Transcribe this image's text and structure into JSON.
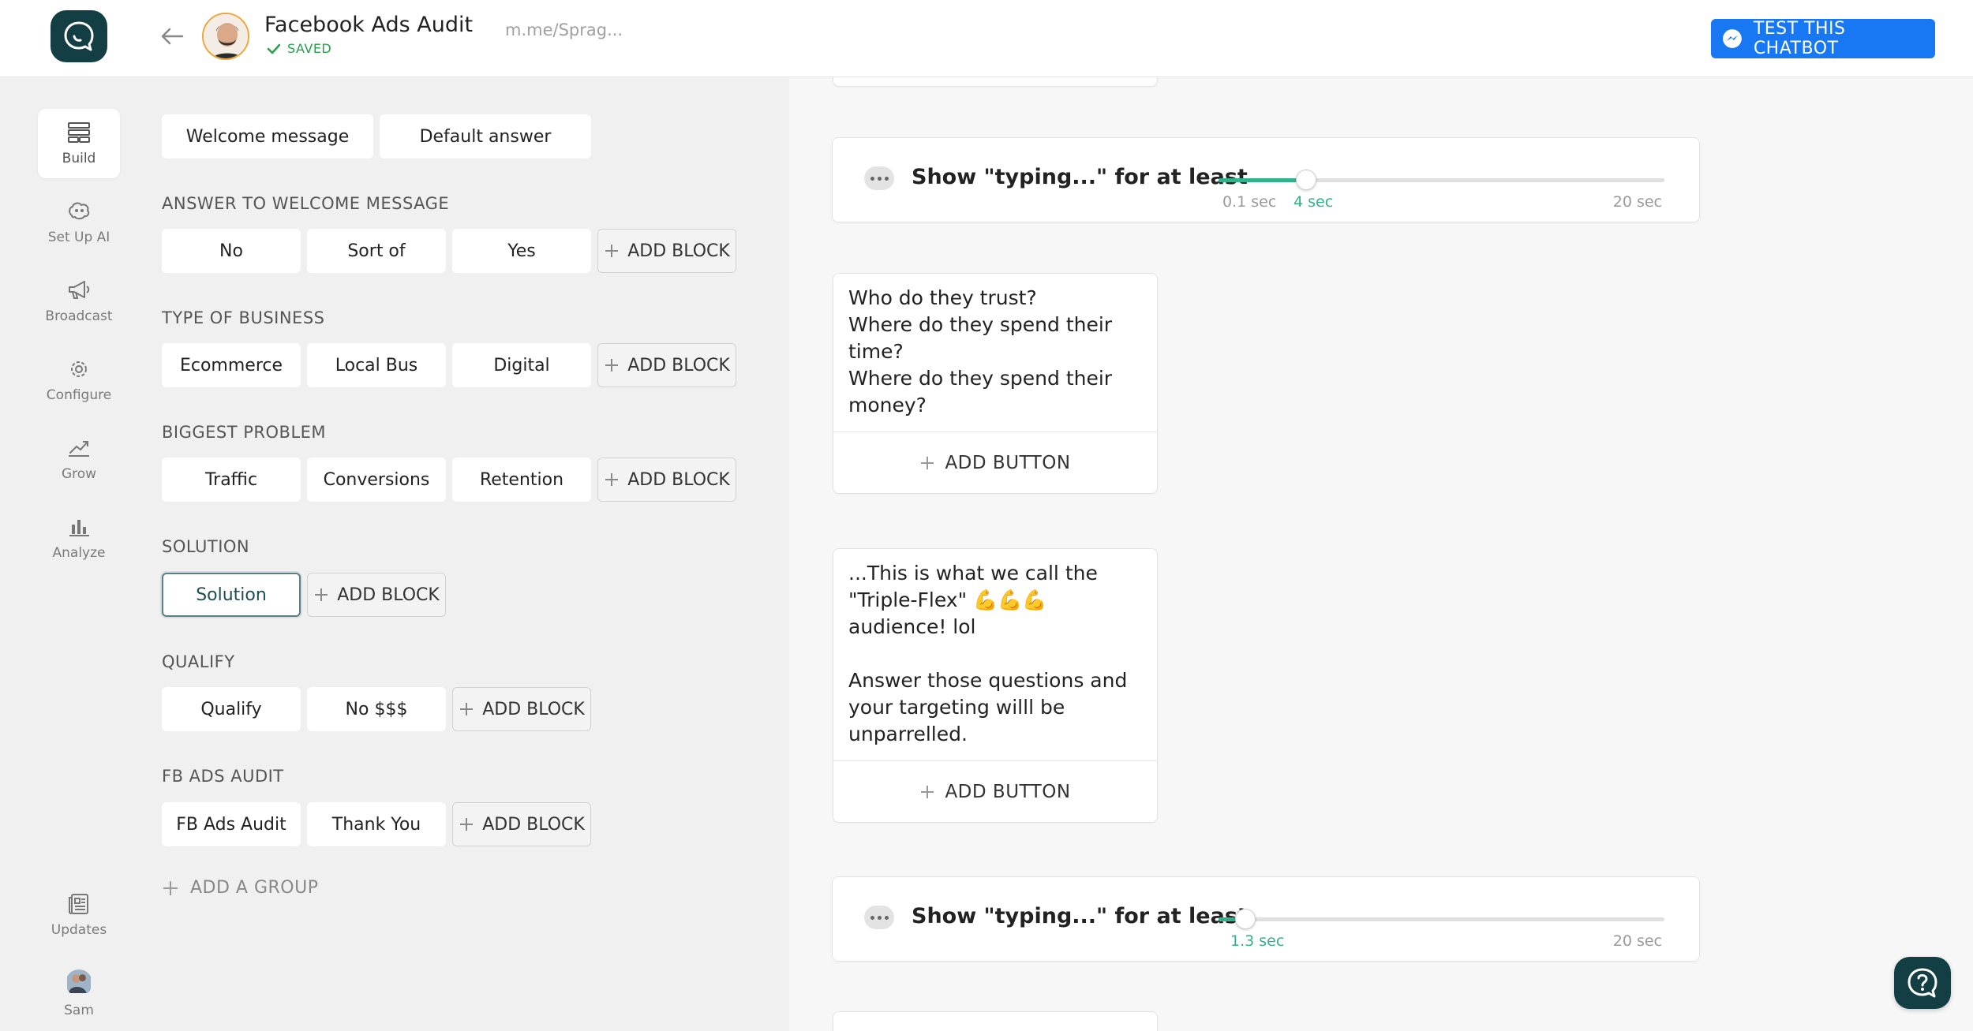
{
  "header": {
    "bot_name": "Facebook Ads Audit",
    "saved_label": "SAVED",
    "bot_link": "m.me/Sprag...",
    "test_button_label": "TEST THIS CHATBOT"
  },
  "nav": {
    "items": [
      {
        "label": "Build",
        "icon": "build-icon"
      },
      {
        "label": "Set Up AI",
        "icon": "ai-icon"
      },
      {
        "label": "Broadcast",
        "icon": "megaphone-icon"
      },
      {
        "label": "Configure",
        "icon": "gear-icon"
      },
      {
        "label": "Grow",
        "icon": "growth-icon"
      },
      {
        "label": "Analyze",
        "icon": "bar-chart-icon"
      }
    ],
    "updates_label": "Updates",
    "user_label": "Sam"
  },
  "blocks": {
    "top": [
      "Welcome message",
      "Default answer"
    ],
    "add_block_label": "ADD BLOCK",
    "add_group_label": "ADD A GROUP",
    "groups": [
      {
        "title": "ANSWER TO WELCOME MESSAGE",
        "blocks": [
          "No",
          "Sort of",
          "Yes"
        ]
      },
      {
        "title": "TYPE OF BUSINESS",
        "blocks": [
          "Ecommerce",
          "Local Bus",
          "Digital"
        ]
      },
      {
        "title": "BIGGEST PROBLEM",
        "blocks": [
          "Traffic",
          "Conversions",
          "Retention"
        ]
      },
      {
        "title": "SOLUTION",
        "blocks": [
          "Solution"
        ]
      },
      {
        "title": "QUALIFY",
        "blocks": [
          "Qualify",
          "No $$$"
        ]
      },
      {
        "title": "FB ADS AUDIT",
        "blocks": [
          "FB Ads Audit",
          "Thank You"
        ]
      }
    ],
    "selected_block": "Solution"
  },
  "editor": {
    "typing1": {
      "label": "Show \"typing...\" for at least",
      "min": "0.1 sec",
      "value": "4 sec",
      "max": "20 sec",
      "fraction": 0.196
    },
    "text1": {
      "text": "Who do they trust?\nWhere do they spend their time?\nWhere do they spend their money?",
      "add_button_label": "ADD BUTTON"
    },
    "text2": {
      "text": "...This is what we call the \"Triple-Flex\" 💪💪💪 audience! lol\n\nAnswer those questions and your targeting willl be unparrelled.",
      "add_button_label": "ADD BUTTON"
    },
    "typing2": {
      "label": "Show \"typing...\" for at least",
      "value": "1.3 sec",
      "max": "20 sec",
      "fraction": 0.061
    }
  },
  "colors": {
    "accent": "#32b28c",
    "brand": "#123e44",
    "messenger": "#1877f2"
  }
}
